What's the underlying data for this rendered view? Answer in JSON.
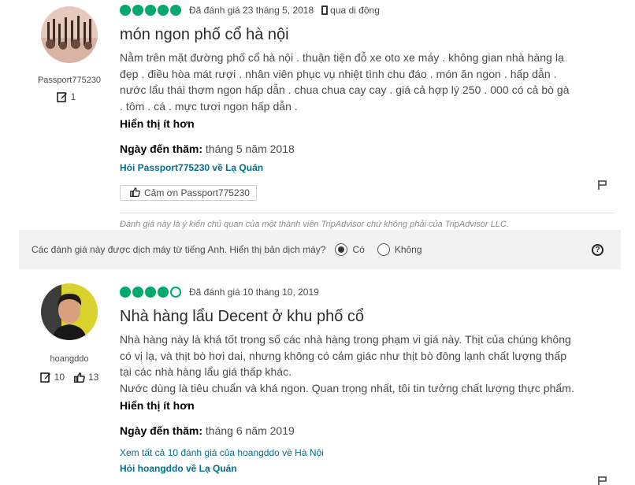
{
  "reviews": [
    {
      "username": "Passport775230",
      "contributions": "1",
      "helpful_votes": "",
      "rating": 5,
      "date": "Đã đánh giá 23 tháng 5, 2018",
      "via": "qua di động",
      "title": "món ngon phố cổ hà nội",
      "body": "Nằm trên mặt đường phố cổ hà nội . thuận tiện đỗ xe oto xe máy . không gian nhà hàng lạ đẹp . điều hòa mát rượi . nhân viên phục vụ nhiệt tình chu đáo . món ăn ngon . hấp dẫn . nước lẩu thái thơm ngon hấp dẫn . chua chua cay cay . giá cả hợp lý 250 . 000 có cả bò gà . tôm . cá . mực tươi ngon hấp dẫn .",
      "show_less": "Hiển thị ít hơn",
      "visit_label": "Ngày đến thăm:",
      "visit_value": "tháng 5 năm 2018",
      "ask_link": "Hỏi Passport775230 về Lạ Quán",
      "thank_label": "Cảm ơn Passport775230",
      "disclaimer": "Đánh giá này là ý kiến chủ quan của một thành viên TripAdvisor chứ không phải của TripAdvisor LLC."
    },
    {
      "username": "hoangddo",
      "contributions": "10",
      "helpful_votes": "13",
      "rating": 4,
      "date": "Đã đánh giá 10 tháng 10, 2019",
      "title": "Nhà hàng lẩu Decent ở khu phố cổ",
      "body_lines": [
        "Nhà hàng này là khá tốt trong số các nhà hàng trong phạm vi giá này. Thịt của chúng không",
        "có vị lạ, và thịt bò hơi dai, nhưng không có cảm giác như thịt bò đông lạnh chất lượng thấp",
        "tại các nhà hàng lẩu giá thấp khác.",
        "Nước dùng là tiêu chuẩn và khá ngon. Quan trọng nhất, tôi tin tưởng chất lượng thực phẩm."
      ],
      "show_less": "Hiển thị ít hơn",
      "visit_label": "Ngày đến thăm:",
      "visit_value": "tháng 6 năm 2019",
      "all_reviews_link": "Xem tất cả 10 đánh giá của hoangddo về Hà Nội",
      "ask_link": "Hỏi hoangddo về Lạ Quán"
    }
  ],
  "translate_bar": {
    "question": "Các đánh giá này được dịch máy từ tiếng Anh. Hiển thị bản dịch máy?",
    "yes": "Có",
    "no": "Không",
    "selected": "yes"
  },
  "colors": {
    "bubble": "#00aa6c",
    "link": "#006f8f",
    "bar": "#f2f2f2"
  },
  "icons": [
    "pencil-icon",
    "thumbs-up-icon",
    "flag-icon",
    "help-icon",
    "mobile-icon"
  ]
}
